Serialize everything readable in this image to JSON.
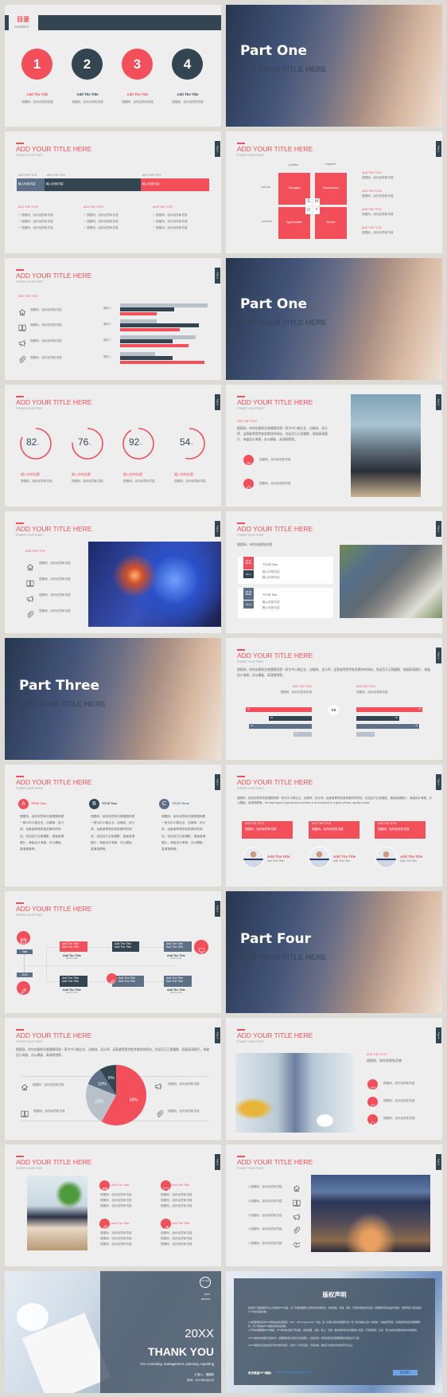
{
  "colors": {
    "accent": "#f24f5a",
    "dark": "#344552",
    "slate": "#5d7085",
    "light": "#b8c0ca",
    "slide_bg": "#eeeeee"
  },
  "common": {
    "title": "ADD YOUR TITLE HERE",
    "subtitle": "POWER YOUR POINT",
    "add_the_title_caps": "ADD THE TITLE",
    "add_the_title": "Add The Title",
    "filler": "搜图网，给你创意和灵感",
    "input_content": "输入你的内容",
    "input_title": "输入你的标题",
    "paragraph": "搜图网，给你创意和灵感搜图网是一家为中小微企业、自媒体、设计师、运营者等提供各类素材的网站，包括百万正版摄影、插画高清图片，海量设计海报、办公模板、高清视频等。",
    "check": "✓"
  },
  "tabs": {
    "p1": "Part 1",
    "p2": "Part 2",
    "p3": "Part 3",
    "p4": "Part 4"
  },
  "s1": {
    "title": "目录",
    "subtitle": "CONTENTS",
    "items": [
      {
        "num": "1",
        "label": "Add The Title",
        "desc": "搜图网，给你创意和灵感"
      },
      {
        "num": "2",
        "label": "Add The Title",
        "desc": "搜图网，给你创意和灵感"
      },
      {
        "num": "3",
        "label": "Add The Title",
        "desc": "搜图网，给你创意和灵感"
      },
      {
        "num": "4",
        "label": "Add The Title",
        "desc": "搜图网，给你创意和灵感"
      }
    ]
  },
  "parts": {
    "one": "Part One",
    "three": "Part Three",
    "four": "Part Four",
    "sub": "ADD YOUR TITLE HERE"
  },
  "s4": {
    "positive": "positive",
    "negative": "negative",
    "internal": "internal",
    "external": "external",
    "quadrants": [
      "Strengths",
      "Weaknesses",
      "opportunities",
      "threats"
    ],
    "letters": [
      "S",
      "W",
      "O",
      "T"
    ]
  },
  "s7": {
    "rings": [
      {
        "value": 82,
        "unit": "%"
      },
      {
        "value": 76,
        "unit": "%"
      },
      {
        "value": 92,
        "unit": "%"
      },
      {
        "value": 54,
        "unit": "%"
      }
    ]
  },
  "s10": {
    "cards": [
      {
        "num": "01",
        "no": "NO.1",
        "title": "TITLE One"
      },
      {
        "num": "02",
        "no": "NO.2",
        "title": "TITLE Two"
      }
    ]
  },
  "s12": {
    "vs": "VS"
  },
  "s13": {
    "items": [
      {
        "letter": "A",
        "title": "TITLE One"
      },
      {
        "letter": "B",
        "title": "TITLE Two"
      },
      {
        "letter": "C",
        "title": "TITLE Three"
      }
    ]
  },
  "s14": {
    "paragraph": "搜图网，给你创意和灵感搜图网是一家为中小微企业、自媒体、设计师、运营者等提供各类素材的网站，包括百万正版摄影、插画高清图片，海量设计海报、办公模板、高清视频等。he total output of goods and services of an economy in a given period, usually a year."
  },
  "s15": {
    "start": "Start",
    "year": "20XX",
    "box_line": "Add The Title"
  },
  "s20": {
    "items": [
      "1.搜图网，给你创意和灵感",
      "2.搜图网，给你创意和灵感",
      "3.搜图网，给你创意和灵感",
      "4.搜图网，给你创意和灵感",
      "1.搜图网，给你创意和灵感"
    ]
  },
  "s21": {
    "logo": "LO GO",
    "year_small": "20XX",
    "design": "DESIGN",
    "year": "20XX",
    "thanks": "THANK YOU",
    "tagline": "For consulting, management, planning, reporting",
    "reporter": "汇报人：搜图网",
    "time": "时间：20XX年X月X日"
  },
  "s22": {
    "title": "版权声明",
    "p0": "感谢您下载搜图网平台上提供的PPT作品，为了您和搜图网以及原创作者的利益，请勿复制、传播、销售，否则将承担法律责任！搜图网将对作品进行维权，按照传播下载次数进行十倍的索取赔偿！",
    "p1": "1.在搜图网出售的PPT模板是由免费版权（VRF：VIP Royalty-Free）作品，受《中国人民共和国著作法》和《世界版权公约》的保护，作品的所有权、版权和著作权归搜图网所有，您下载的是PPT模板素材的使用权。",
    "p2": "2.不得将搜图网的PPT模板、PPT素材本身用于再出售，或者出租、出借、转让、分销、发布或者作为礼物供他人使用，不得转授权、出卖、转让本协议或者本协议中的权利。",
    "p3": "3.PPT模板中的图片仅供参考，搜图网提供大量高清正版图片，如需商用，如有需要请至搜图网图片频道进行下载。",
    "p4": "4.PPT模板中包含的创意字体为参考展示，仅供个人学习使用，不得商用，网站不对您的字体使用行为负责。",
    "more": "更多精品PPT模板：",
    "link": "http://www.soutu.com/ppt.html",
    "button": "点击进入"
  },
  "chart_data": [
    {
      "type": "bar",
      "orientation": "horizontal",
      "categories": [
        "类别 4",
        "类别 3",
        "类别 2",
        "类别 1"
      ],
      "series": [
        {
          "color": "#b8c0ca",
          "values": [
            5.0,
            2.1,
            4.3,
            2.0
          ]
        },
        {
          "color": "#344552",
          "values": [
            3.1,
            4.5,
            3.0,
            3.0
          ]
        },
        {
          "color": "#f24f5a",
          "values": [
            2.1,
            3.4,
            3.9,
            4.8
          ]
        }
      ],
      "xlim": [
        0,
        5
      ],
      "grid": false
    },
    {
      "type": "bar",
      "orientation": "horizontal",
      "layout": "mirrored",
      "series": [
        {
          "side": "left",
          "values": [
            83,
            54,
            79,
            23
          ]
        },
        {
          "side": "right",
          "values": [
            83,
            54,
            79,
            23
          ]
        }
      ],
      "colors": [
        "#f24f5a",
        "#344552",
        "#5d7085",
        "#b8c0ca"
      ]
    },
    {
      "type": "pie",
      "labels": [
        "58%",
        "23%",
        "10%",
        "9%"
      ],
      "values": [
        58,
        23,
        10,
        9
      ],
      "colors": [
        "#f24f5a",
        "#b8c0ca",
        "#5d7085",
        "#344552"
      ]
    }
  ]
}
